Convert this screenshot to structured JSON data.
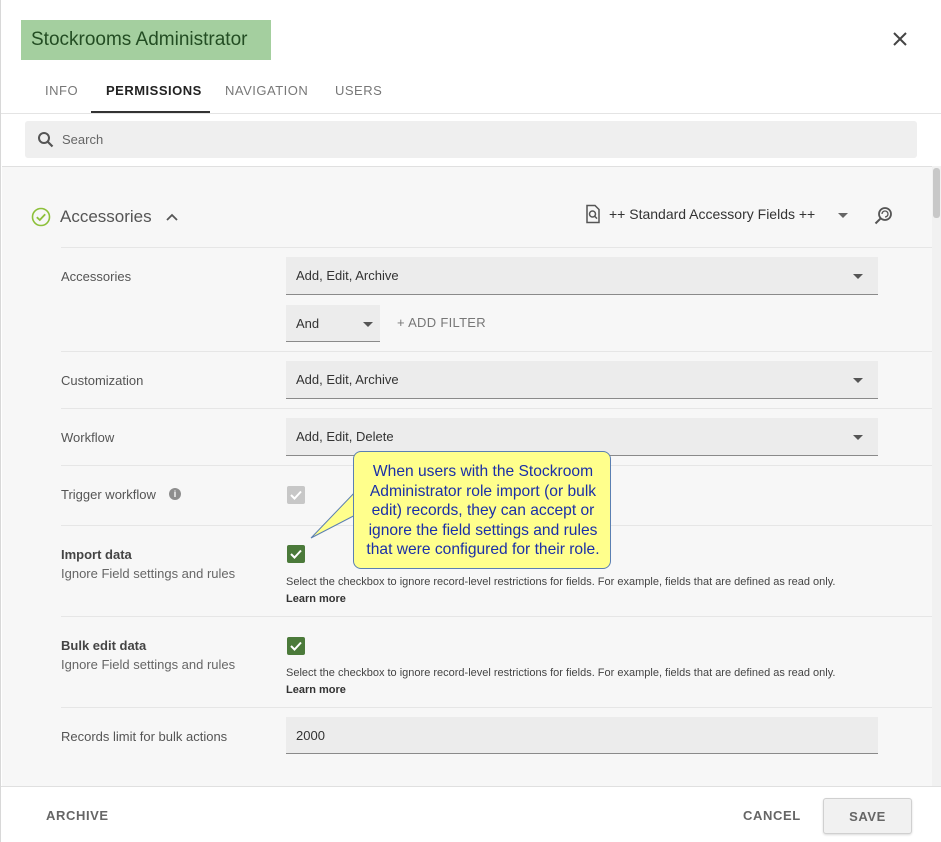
{
  "header": {
    "title": "Stockrooms Administrator",
    "title_bg": "#a4cf9f"
  },
  "tabs": [
    {
      "label": "INFO",
      "active": false
    },
    {
      "label": "PERMISSIONS",
      "active": true
    },
    {
      "label": "NAVIGATION",
      "active": false
    },
    {
      "label": "USERS",
      "active": false
    }
  ],
  "search": {
    "placeholder": "Search"
  },
  "section": {
    "title": "Accessories",
    "fieldset": "++ Standard Accessory Fields ++"
  },
  "rows": {
    "accessories": {
      "label": "Accessories",
      "value": "Add, Edit, Archive"
    },
    "filter": {
      "operator": "And",
      "add_filter": "+ ADD FILTER"
    },
    "customization": {
      "label": "Customization",
      "value": "Add, Edit, Archive"
    },
    "workflow": {
      "label": "Workflow",
      "value": "Add, Edit, Delete"
    },
    "trigger_workflow": {
      "label": "Trigger workflow",
      "checked": true,
      "disabled": true
    },
    "import_data": {
      "label": "Import data",
      "sub": "Ignore Field settings and rules",
      "checked": true,
      "help": "Select the checkbox to ignore record-level restrictions for fields. For example, fields that are defined as read only.",
      "learn": "Learn more"
    },
    "bulk_edit": {
      "label": "Bulk edit data",
      "sub": "Ignore Field settings and rules",
      "checked": true,
      "help": "Select the checkbox to ignore record-level restrictions for fields. For example, fields that are defined as read only.",
      "learn": "Learn more"
    },
    "records_limit": {
      "label": "Records limit for bulk actions",
      "value": "2000"
    }
  },
  "callout": {
    "text": "When users with the Stockroom Administrator role import (or bulk edit) records, they can accept or ignore the field settings and rules that were configured for their role."
  },
  "footer": {
    "archive": "ARCHIVE",
    "cancel": "CANCEL",
    "save": "SAVE"
  },
  "colors": {
    "check_green": "#4b7a3a",
    "status_green": "#8dc03a",
    "callout_bg": "#ffff8c",
    "callout_text": "#1a2fa8"
  }
}
